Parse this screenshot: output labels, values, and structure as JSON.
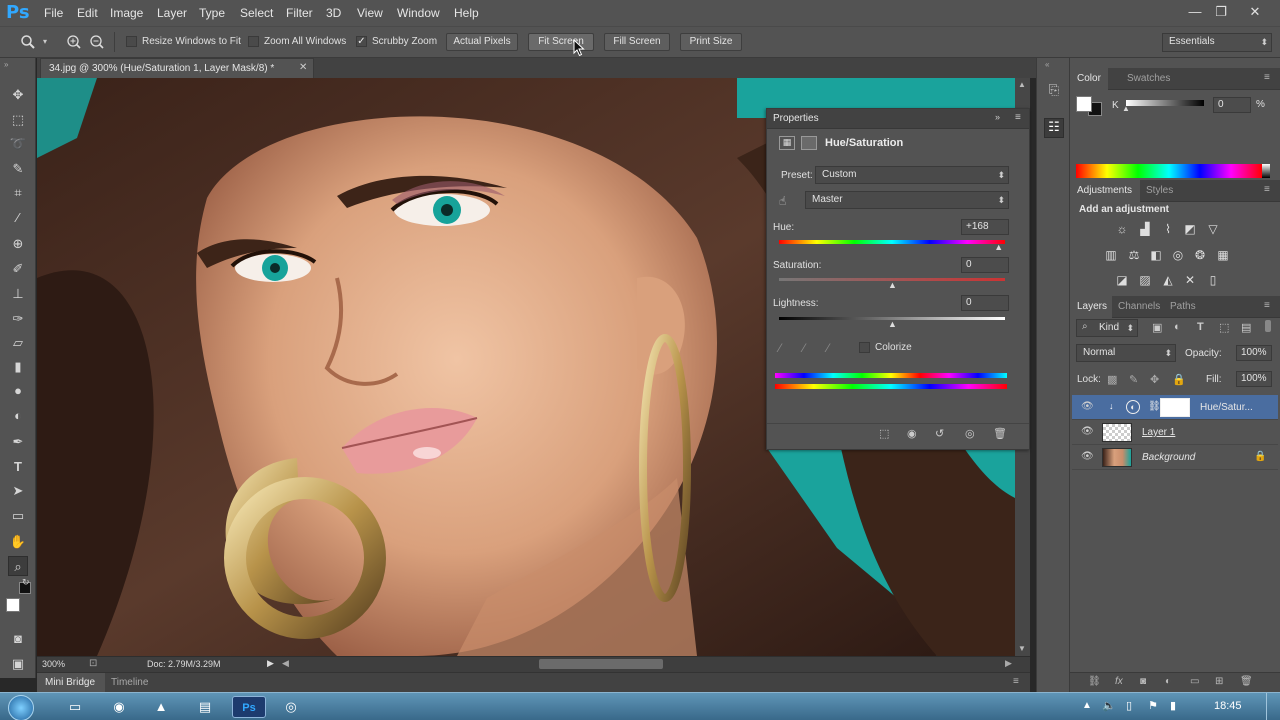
{
  "app": {
    "logo": "Ps",
    "menu": [
      "File",
      "Edit",
      "Image",
      "Layer",
      "Type",
      "Select",
      "Filter",
      "3D",
      "View",
      "Window",
      "Help"
    ],
    "window_controls": {
      "minimize": "—",
      "restore": "❐",
      "close": "✕"
    }
  },
  "options_bar": {
    "resize_windows": {
      "label": "Resize Windows to Fit",
      "checked": false
    },
    "zoom_all": {
      "label": "Zoom All Windows",
      "checked": false
    },
    "scrubby_zoom": {
      "label": "Scrubby Zoom",
      "checked": true
    },
    "buttons": [
      "Actual Pixels",
      "Fit Screen",
      "Fill Screen",
      "Print Size"
    ],
    "workspace": "Essentials"
  },
  "document": {
    "tab_title": "34.jpg @ 300% (Hue/Saturation 1, Layer Mask/8) *",
    "zoom": "300%",
    "doc_info": "Doc: 2.79M/3.29M"
  },
  "bottom_tabs": [
    "Mini Bridge",
    "Timeline"
  ],
  "properties": {
    "panel_title": "Properties",
    "title": "Hue/Saturation",
    "preset_label": "Preset:",
    "preset_value": "Custom",
    "channel_value": "Master",
    "hue_label": "Hue:",
    "hue_value": "+168",
    "saturation_label": "Saturation:",
    "saturation_value": "0",
    "lightness_label": "Lightness:",
    "lightness_value": "0",
    "colorize_label": "Colorize",
    "colorize_checked": false,
    "hue_level_pct": 0.97,
    "saturation_level_pct": 0.5,
    "lightness_level_pct": 0.5
  },
  "color_panel": {
    "tabs": [
      "Color",
      "Swatches"
    ],
    "channel_label": "K",
    "value": "0",
    "unit": "%"
  },
  "adjustments_panel": {
    "tabs": [
      "Adjustments",
      "Styles"
    ],
    "heading": "Add an adjustment"
  },
  "layers_panel": {
    "tabs": [
      "Layers",
      "Channels",
      "Paths"
    ],
    "filter_kind": "Kind",
    "blend_mode": "Normal",
    "opacity_label": "Opacity:",
    "opacity_value": "100%",
    "lock_label": "Lock:",
    "fill_label": "Fill:",
    "fill_value": "100%",
    "layers": [
      {
        "name": "Hue/Satur...",
        "type": "adjustment",
        "selected": true
      },
      {
        "name": "Layer 1",
        "type": "transparent",
        "selected": false
      },
      {
        "name": "Background",
        "type": "photo",
        "selected": false,
        "locked": true
      }
    ]
  },
  "taskbar": {
    "time": "18:45"
  },
  "colors": {
    "accent": "#31a8ff",
    "panel_bg": "#535353",
    "selected_layer": "#4a6da0",
    "teal_background": "#1aa39c"
  }
}
